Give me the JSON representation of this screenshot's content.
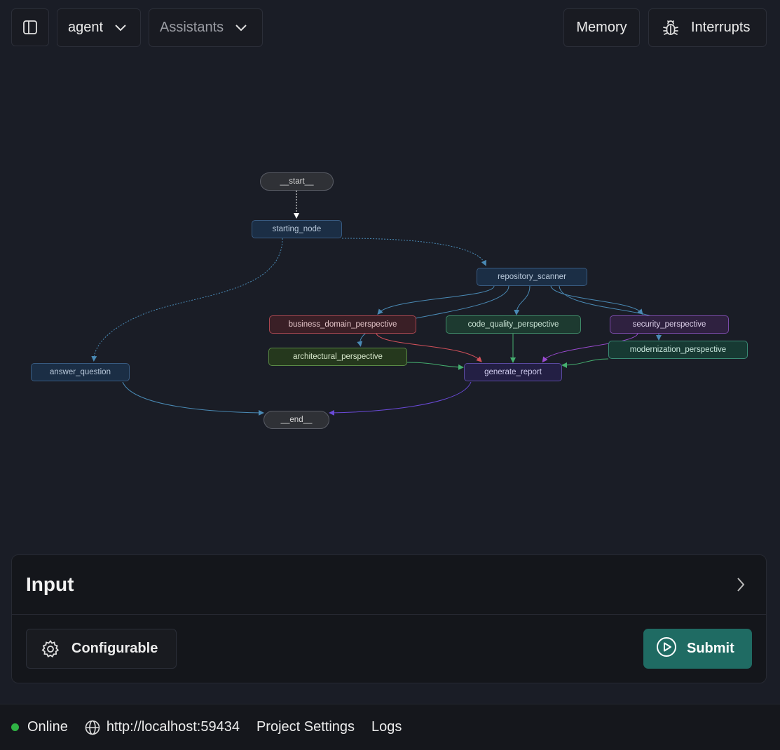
{
  "header": {
    "graph_select": "agent",
    "assistants_select": "Assistants",
    "memory_label": "Memory",
    "interrupts_label": "Interrupts"
  },
  "graph": {
    "nodes": {
      "start": "__start__",
      "starting_node": "starting_node",
      "repository_scanner": "repository_scanner",
      "business_domain_perspective": "business_domain_perspective",
      "code_quality_perspective": "code_quality_perspective",
      "security_perspective": "security_perspective",
      "architectural_perspective": "architectural_perspective",
      "modernization_perspective": "modernization_perspective",
      "answer_question": "answer_question",
      "generate_report": "generate_report",
      "end": "__end__"
    },
    "colors": {
      "blue_edge": "#4a8ab5",
      "red_edge": "#d0505a",
      "green_edge": "#45b070",
      "purple_edge": "#9a4ad0",
      "end_edge": "#6a4ad8"
    }
  },
  "input_panel": {
    "title": "Input",
    "configurable_label": "Configurable",
    "submit_label": "Submit",
    "submit_color": "#1f6b63"
  },
  "footer": {
    "status": "Online",
    "status_color": "#2fb344",
    "url": "http://localhost:59434",
    "project_settings": "Project Settings",
    "logs": "Logs"
  }
}
